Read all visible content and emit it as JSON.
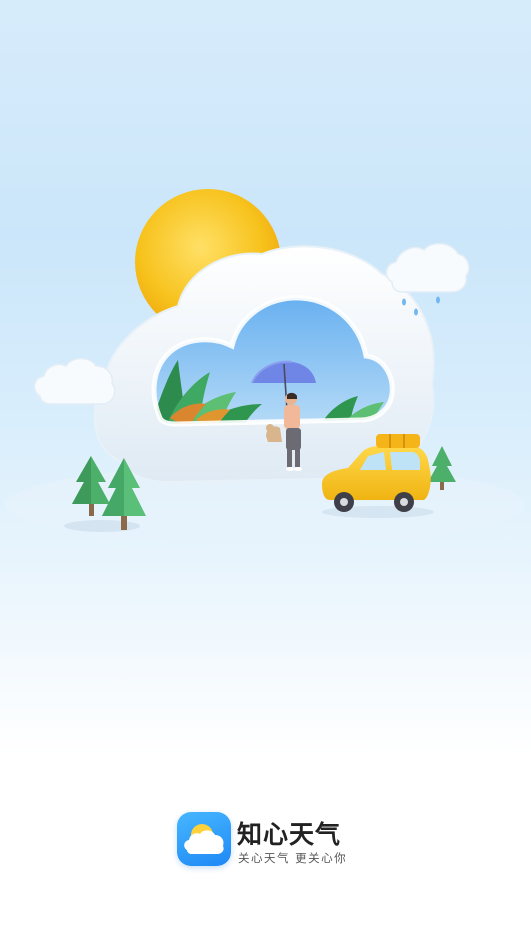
{
  "app": {
    "name": "知心天气",
    "slogan": "关心天气  更关心你"
  },
  "colors": {
    "sky_top": "#d7ecfb",
    "sky_bottom": "#ffffff",
    "sun": "#f7c21c",
    "cloud_frame": "#f3f8fc",
    "window_sky": "#8fc4f0",
    "umbrella": "#6f86e6",
    "car": "#f7c51e",
    "tree": "#4caf6a",
    "icon_blue": "#1e88f5"
  }
}
